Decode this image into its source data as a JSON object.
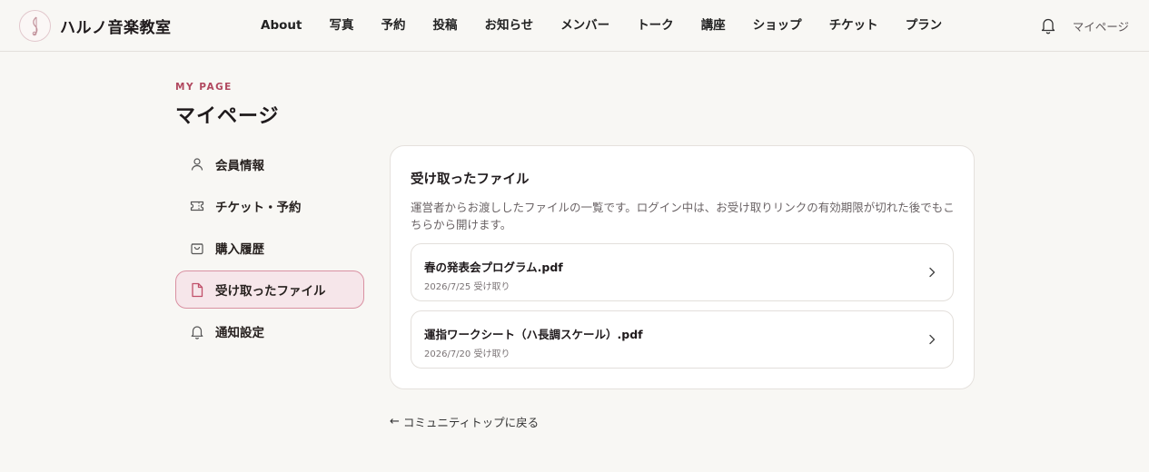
{
  "header": {
    "brand_name": "ハルノ音楽教室",
    "nav": [
      "About",
      "写真",
      "予約",
      "投稿",
      "お知らせ",
      "メンバー",
      "トーク",
      "講座",
      "ショップ",
      "チケット",
      "プラン"
    ],
    "mypage_label": "マイページ",
    "bell_icon": "bell-icon"
  },
  "page": {
    "eyebrow": "MY PAGE",
    "title": "マイページ"
  },
  "sidebar": {
    "items": [
      {
        "label": "会員情報",
        "icon": "user-icon",
        "active": false
      },
      {
        "label": "チケット・予約",
        "icon": "ticket-icon",
        "active": false
      },
      {
        "label": "購入履歴",
        "icon": "shopping-bag-icon",
        "active": false
      },
      {
        "label": "受け取ったファイル",
        "icon": "file-icon",
        "active": true
      },
      {
        "label": "通知設定",
        "icon": "bell-icon",
        "active": false
      }
    ]
  },
  "main": {
    "title": "受け取ったファイル",
    "description": "運営者からお渡ししたファイルの一覧です。ログイン中は、お受け取りリンクの有効期限が切れた後でもこちらから開けます。",
    "files": [
      {
        "name": "春の発表会プログラム.pdf",
        "date": "2026/7/25 受け取り"
      },
      {
        "name": "運指ワークシート（ハ長調スケール）.pdf",
        "date": "2026/7/20 受け取り"
      }
    ]
  },
  "back_link": "コミュニティトップに戻る",
  "colors": {
    "accent": "#b1485f",
    "active_bg": "#f6e6ea",
    "active_border": "#d991a2",
    "background": "#f8f7f4"
  }
}
